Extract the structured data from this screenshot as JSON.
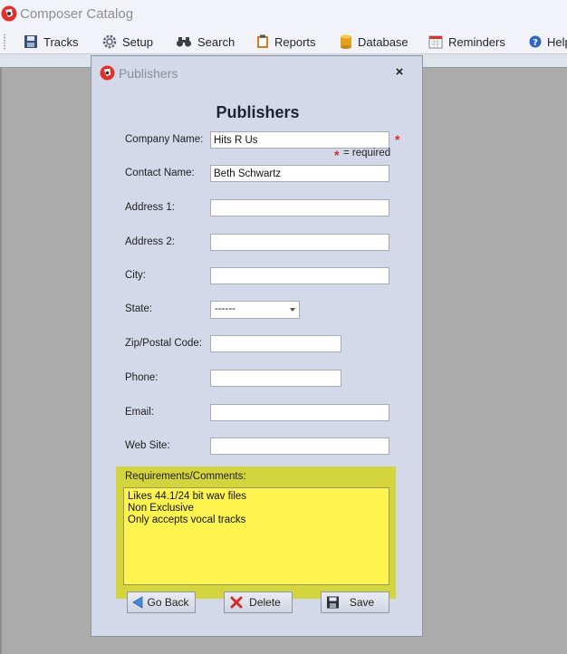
{
  "app": {
    "title": "Composer Catalog"
  },
  "toolbar": {
    "items": [
      {
        "label": "Tracks",
        "icon": "tracks-icon"
      },
      {
        "label": "Setup",
        "icon": "gear-icon"
      },
      {
        "label": "Search",
        "icon": "binoculars-icon"
      },
      {
        "label": "Reports",
        "icon": "clipboard-icon"
      },
      {
        "label": "Database",
        "icon": "database-icon"
      },
      {
        "label": "Reminders",
        "icon": "calendar-icon"
      },
      {
        "label": "Help",
        "icon": "help-icon"
      }
    ]
  },
  "dialog": {
    "title": "Publishers",
    "heading": "Publishers",
    "close": "×",
    "required_note": "= required",
    "fields": {
      "company": {
        "label": "Company Name:",
        "value": "Hits R Us"
      },
      "contact": {
        "label": "Contact Name:",
        "value": "Beth Schwartz"
      },
      "address1": {
        "label": "Address 1:",
        "value": ""
      },
      "address2": {
        "label": "Address 2:",
        "value": ""
      },
      "city": {
        "label": "City:",
        "value": ""
      },
      "state": {
        "label": "State:",
        "value": "------"
      },
      "zip": {
        "label": "Zip/Postal Code:",
        "value": ""
      },
      "phone": {
        "label": "Phone:",
        "value": ""
      },
      "email": {
        "label": "Email:",
        "value": ""
      },
      "website": {
        "label": "Web Site:",
        "value": ""
      }
    },
    "comments": {
      "label": "Requirements/Comments:",
      "lines": [
        "Likes 44.1/24 bit wav files",
        "Non Exclusive",
        "Only accepts vocal tracks"
      ]
    },
    "buttons": {
      "back": "Go Back",
      "delete": "Delete",
      "save": "Save"
    }
  },
  "colors": {
    "dialog_bg": "#d3d9e9",
    "highlight": "#d4d43f",
    "comments_bg": "#fff44f",
    "required": "#e0262b"
  }
}
